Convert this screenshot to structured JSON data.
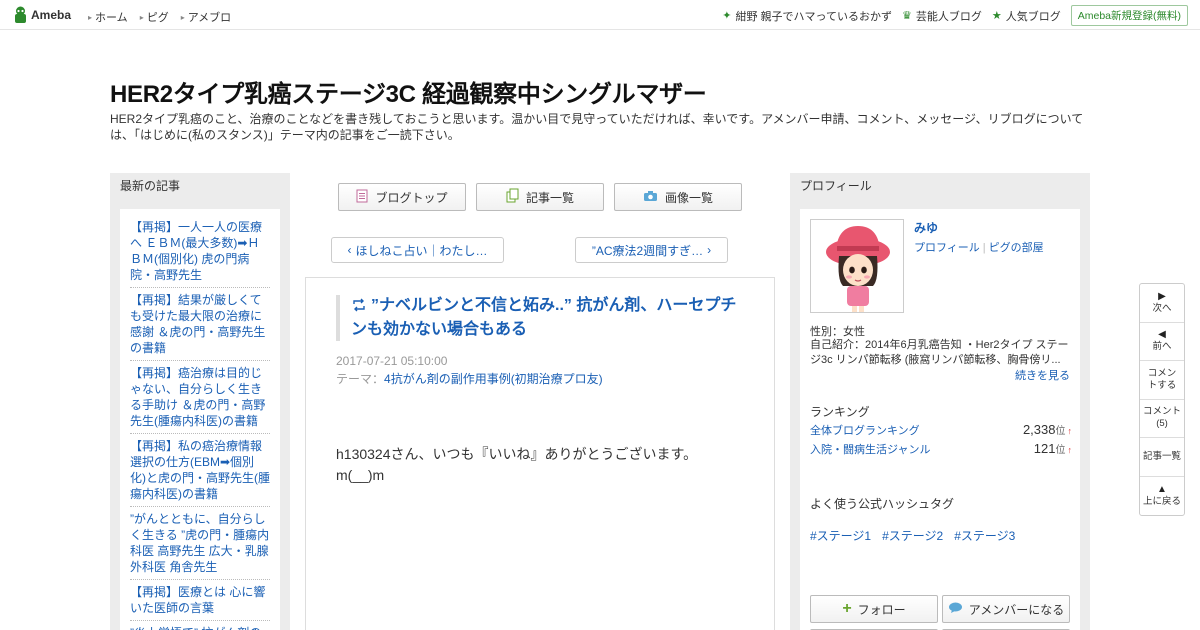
{
  "header": {
    "logo_text": "Ameba",
    "nav": [
      "ホーム",
      "ピグ",
      "アメブロ"
    ],
    "right_links": [
      {
        "icon": "sparkle-icon",
        "label": "紺野 親子でハマっているおかず"
      },
      {
        "icon": "crown-icon",
        "label": "芸能人ブログ"
      },
      {
        "icon": "star-icon",
        "label": "人気ブログ"
      }
    ],
    "signup_label": "Ameba新規登録(無料)"
  },
  "blog": {
    "title": "HER2タイプ乳癌ステージ3C 経過観察中シングルマザー",
    "description": "HER2タイプ乳癌のこと、治療のことなどを書き残しておこうと思います。温かい目で見守っていただければ、幸いです。アメンバー申請、コメント、メッセージ、リブログについては、「はじめに(私のスタンス)」テーマ内の記事をご一読下さい。"
  },
  "left": {
    "heading": "最新の記事",
    "items": [
      "【再掲】一人一人の医療へ ＥＢＭ(最大多数)➡ＨＢＭ(個別化) 虎の門病院・高野先生",
      "【再掲】結果が厳しくても受けた最大限の治療に感謝 ＆虎の門・高野先生の書籍",
      "【再掲】癌治療は目的じゃない、自分らしく生きる手助け ＆虎の門・高野先生(腫瘍内科医)の書籍",
      "【再掲】私の癌治療情報選択の仕方(EBM➡個別化)と虎の門・高野先生(腫瘍内科医)の書籍",
      "”がんとともに、自分らしく生きる ”虎の門・腫瘍内科医 高野先生 広大・乳腺外科医 角舎先生",
      "【再掲】医療とは 心に響いた医師の言葉",
      "”炎上覚悟で” 抗がん剤の"
    ]
  },
  "center": {
    "nav_buttons": [
      {
        "icon": "document-icon",
        "label": "ブログトップ"
      },
      {
        "icon": "copy-icon",
        "label": "記事一覧"
      },
      {
        "icon": "camera-icon",
        "label": "画像一覧"
      }
    ],
    "prev_label": "ほしねこ占い｜わたし…",
    "next_label": "”AC療法2週間すぎ…"
  },
  "article": {
    "title": "”ナベルビンと不信と妬み..” 抗がん剤、ハーセプチンも効かない場合もある",
    "date": "2017-07-21 05:10:00",
    "theme_prefix": "テーマ：",
    "theme": "4抗がん剤の副作用事例(初期治療プロ友)",
    "body_line1": "h130324さん、いつも『いいね』ありがとうございます。",
    "body_line2": "m(__)m"
  },
  "profile": {
    "heading": "プロフィール",
    "name": "みゆ",
    "link_profile": "プロフィール",
    "link_pig": "ピグの部屋",
    "gender": "性別：女性",
    "intro": "自己紹介：2014年6月乳癌告知 ・Her2タイプ ステージ3c リンパ節転移 (腋窩リンパ節転移、胸骨傍リ...",
    "more": "続きを見る",
    "ranking_heading": "ランキング",
    "rankings": [
      {
        "label": "全体ブログランキング",
        "value": "2,338",
        "unit": "位",
        "trend": "↑"
      },
      {
        "label": "入院・闘病生活ジャンル",
        "value": "121",
        "unit": "位",
        "trend": "↑"
      }
    ],
    "hashtag_heading": "よく使う公式ハッシュタグ",
    "hashtags": [
      "#ステージ1",
      "#ステージ2",
      "#ステージ3"
    ],
    "follow_label": "フォロー",
    "amember_label": "アメンバーになる"
  },
  "sidenav": [
    {
      "icon": "triangle-right-icon",
      "glyph": "▶",
      "label": "次へ"
    },
    {
      "icon": "triangle-left-icon",
      "glyph": "◀",
      "label": "前へ"
    },
    {
      "icon": "",
      "glyph": "",
      "label": "コメントする"
    },
    {
      "icon": "",
      "glyph": "",
      "label": "コメント(5)"
    },
    {
      "icon": "",
      "glyph": "",
      "label": "記事一覧"
    },
    {
      "icon": "triangle-up-icon",
      "glyph": "▲",
      "label": "上に戻る"
    }
  ],
  "colors": {
    "link": "#1a5fb4",
    "brand_green": "#2d8a2d",
    "panel_gray": "#ececec"
  }
}
